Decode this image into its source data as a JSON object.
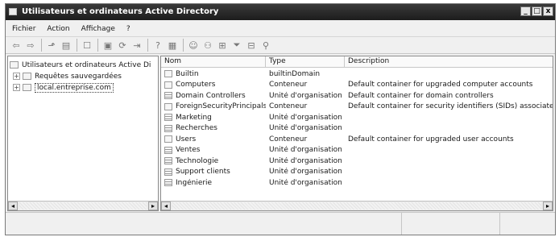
{
  "window": {
    "title": "Utilisateurs et ordinateurs Active Directory",
    "controls": {
      "minimize": "_",
      "maximize": "□",
      "close": "x"
    }
  },
  "menu": {
    "items": [
      {
        "label": "Fichier"
      },
      {
        "label": "Action"
      },
      {
        "label": "Affichage"
      },
      {
        "label": "?"
      }
    ]
  },
  "toolbar": {
    "buttons": [
      {
        "icon": "back-arrow-icon",
        "glyph": "⇦"
      },
      {
        "icon": "forward-arrow-icon",
        "glyph": "⇨"
      },
      {
        "icon": "up-folder-icon",
        "glyph": "⬏"
      },
      {
        "icon": "show-hide-tree-icon",
        "glyph": "▤"
      },
      {
        "icon": "delete-icon",
        "glyph": "☐"
      },
      {
        "icon": "properties-icon",
        "glyph": "▣"
      },
      {
        "icon": "refresh-icon",
        "glyph": "⟳"
      },
      {
        "icon": "export-list-icon",
        "glyph": "⇥"
      },
      {
        "icon": "help-icon",
        "glyph": "?"
      },
      {
        "icon": "console-icon",
        "glyph": "▦"
      },
      {
        "icon": "new-user-icon",
        "glyph": "☺"
      },
      {
        "icon": "new-group-icon",
        "glyph": "⚇"
      },
      {
        "icon": "new-ou-icon",
        "glyph": "⊞"
      },
      {
        "icon": "filter-icon",
        "glyph": "⏷"
      },
      {
        "icon": "add-to-group-icon",
        "glyph": "⊟"
      },
      {
        "icon": "find-users-icon",
        "glyph": "⚲"
      }
    ]
  },
  "tree": {
    "root": "Utilisateurs et ordinateurs Active Di",
    "items": [
      {
        "label": "Requêtes sauvegardées",
        "expander": "+"
      },
      {
        "label": "local.entreprise.com",
        "expander": "+"
      }
    ]
  },
  "list": {
    "columns": {
      "name": "Nom",
      "type": "Type",
      "description": "Description"
    },
    "rows": [
      {
        "name": "Builtin",
        "type": "builtinDomain",
        "description": "",
        "icon": "container-icon"
      },
      {
        "name": "Computers",
        "type": "Conteneur",
        "description": "Default container for upgraded computer accounts",
        "icon": "container-icon"
      },
      {
        "name": "Domain Controllers",
        "type": "Unité d'organisation",
        "description": "Default container for domain controllers",
        "icon": "ou-icon"
      },
      {
        "name": "ForeignSecurityPrincipals",
        "type": "Conteneur",
        "description": "Default container for security identifiers (SIDs) associated with",
        "icon": "container-icon"
      },
      {
        "name": "Marketing",
        "type": "Unité d'organisation",
        "description": "",
        "icon": "ou-icon"
      },
      {
        "name": "Recherches",
        "type": "Unité d'organisation",
        "description": "",
        "icon": "ou-icon"
      },
      {
        "name": "Users",
        "type": "Conteneur",
        "description": "Default container for upgraded user accounts",
        "icon": "container-icon"
      },
      {
        "name": "Ventes",
        "type": "Unité d'organisation",
        "description": "",
        "icon": "ou-icon"
      },
      {
        "name": "Technologie",
        "type": "Unité d'organisation",
        "description": "",
        "icon": "ou-icon"
      },
      {
        "name": "Support clients",
        "type": "Unité d'organisation",
        "description": "",
        "icon": "ou-icon"
      },
      {
        "name": "Ingénierie",
        "type": "Unité d'organisation",
        "description": "",
        "icon": "ou-icon"
      }
    ]
  },
  "scrollbar": {
    "left_glyph": "◂",
    "right_glyph": "▸"
  }
}
